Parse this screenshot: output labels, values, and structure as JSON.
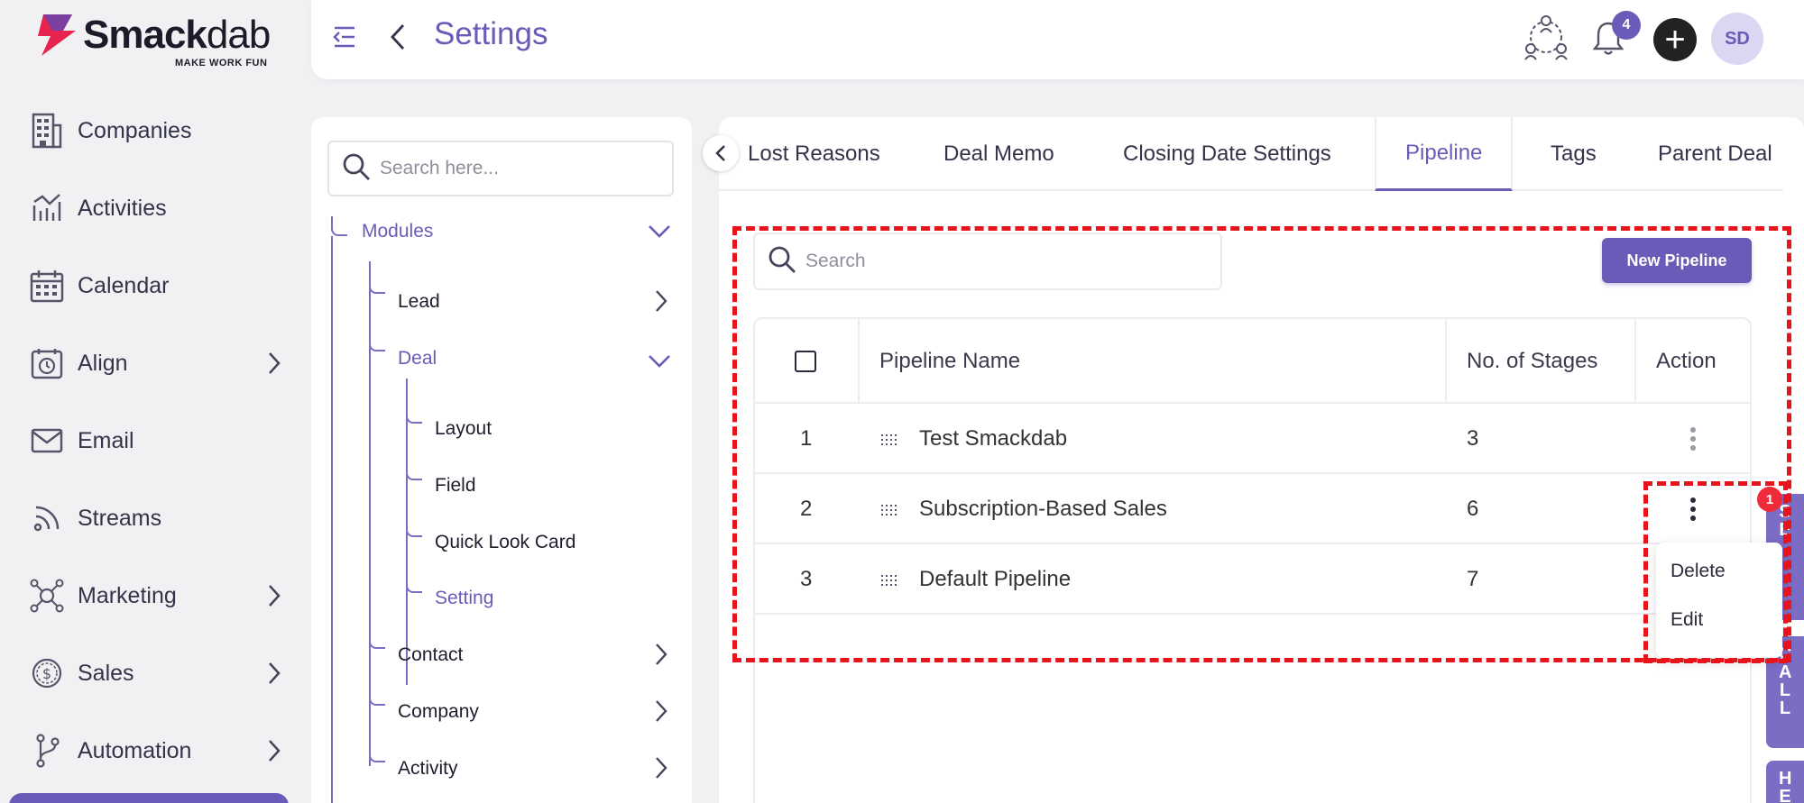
{
  "brand": {
    "name_bold": "Smack",
    "name_light": "dab",
    "tagline": "MAKE WORK FUN"
  },
  "sidebar": {
    "items": [
      {
        "label": "Companies",
        "icon": "building-icon",
        "has_children": false
      },
      {
        "label": "Activities",
        "icon": "activity-chart-icon",
        "has_children": false
      },
      {
        "label": "Calendar",
        "icon": "calendar-icon",
        "has_children": false
      },
      {
        "label": "Align",
        "icon": "clock-calendar-icon",
        "has_children": true
      },
      {
        "label": "Email",
        "icon": "mail-icon",
        "has_children": false
      },
      {
        "label": "Streams",
        "icon": "rss-icon",
        "has_children": false
      },
      {
        "label": "Marketing",
        "icon": "network-icon",
        "has_children": true
      },
      {
        "label": "Sales",
        "icon": "dollar-icon",
        "has_children": true
      },
      {
        "label": "Automation",
        "icon": "branch-icon",
        "has_children": true
      }
    ]
  },
  "header": {
    "title": "Settings",
    "notification_count": "4",
    "plus_symbol": "+",
    "avatar_initials": "SD"
  },
  "settings_nav": {
    "search_placeholder": "Search here...",
    "modules_label": "Modules",
    "lead_label": "Lead",
    "deal_label": "Deal",
    "deal_children": [
      "Layout",
      "Field",
      "Quick Look Card",
      "Setting"
    ],
    "contact_label": "Contact",
    "company_label": "Company",
    "activity_label": "Activity"
  },
  "tabs": {
    "items": [
      "Lost Reasons",
      "Deal Memo",
      "Closing Date Settings",
      "Pipeline",
      "Tags",
      "Parent Deal"
    ],
    "active": "Pipeline"
  },
  "pipeline": {
    "search_placeholder": "Search",
    "new_button": "New Pipeline",
    "columns": {
      "name": "Pipeline Name",
      "stages": "No. of Stages",
      "action": "Action"
    },
    "rows": [
      {
        "index": "1",
        "name": "Test Smackdab",
        "stages": "3"
      },
      {
        "index": "2",
        "name": "Subscription-Based Sales",
        "stages": "6"
      },
      {
        "index": "3",
        "name": "Default Pipeline",
        "stages": "7"
      }
    ]
  },
  "action_menu": {
    "delete": "Delete",
    "edit": "Edit",
    "step_badge": "1"
  },
  "side_tabs": {
    "tab1": "S E",
    "tab2": "C A L L",
    "tab3": "H E"
  },
  "colors": {
    "accent": "#6b5bb8",
    "annotation": "#e8141c",
    "badge": "#ef2b3a"
  }
}
